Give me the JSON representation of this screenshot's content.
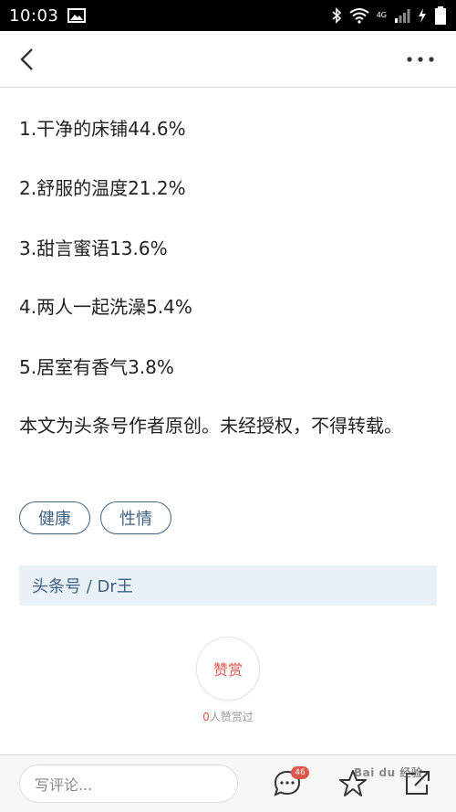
{
  "status_bar": {
    "time": "10:03",
    "network_label": "4G"
  },
  "article": {
    "list_items": [
      "1.干净的床铺44.6%",
      "2.舒服的温度21.2%",
      "3.甜言蜜语13.6%",
      "4.两人一起洗澡5.4%",
      "5.居室有香气3.8%"
    ],
    "copyright_notice": "本文为头条号作者原创。未经授权，不得转载。",
    "tags": [
      "健康",
      "性情"
    ],
    "source": "头条号 / Dr王"
  },
  "reward": {
    "button_label": "赞赏",
    "count": "0",
    "count_suffix": "人赞赏过"
  },
  "bottom_bar": {
    "comment_placeholder": "写评论...",
    "comment_count": "46",
    "watermark": "Bai du 经验"
  },
  "colors": {
    "accent_blue": "#3f6287",
    "reward_red": "#e0554a",
    "source_bg": "#e9f0f6"
  },
  "icons": [
    "image-icon",
    "bluetooth-icon",
    "wifi-icon",
    "signal-icon",
    "charging-icon",
    "battery-icon",
    "back-arrow-icon",
    "more-icon",
    "comment-icon",
    "star-icon",
    "share-icon"
  ]
}
